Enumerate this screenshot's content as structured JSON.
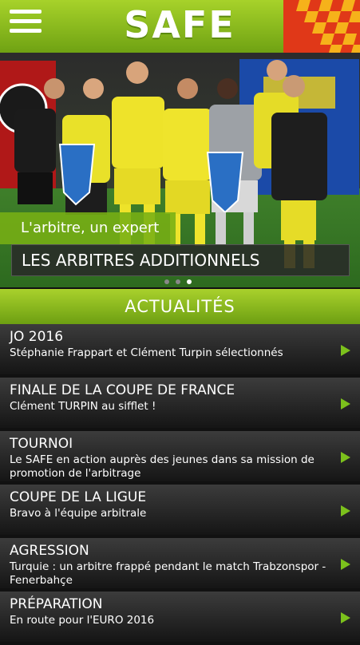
{
  "header": {
    "logo_text": "SAFE",
    "menu_icon": "hamburger-icon",
    "accent": "#8cc21e"
  },
  "hero": {
    "tag": "L'arbitre, un expert",
    "title": "LES ARBITRES ADDITIONNELS",
    "slides_total": 3,
    "active_slide": 3
  },
  "section": {
    "title": "ACTUALITÉS"
  },
  "news": [
    {
      "title": "JO 2016",
      "subtitle": "Stéphanie Frappart et Clément Turpin sélectionnés"
    },
    {
      "title": "FINALE DE LA COUPE DE FRANCE",
      "subtitle": "Clément TURPIN au sifflet !"
    },
    {
      "title": "TOURNOI",
      "subtitle": "Le SAFE en action auprès des jeunes dans sa mission de promotion de l'arbitrage"
    },
    {
      "title": "COUPE DE LA LIGUE",
      "subtitle": "Bravo à l'équipe arbitrale"
    },
    {
      "title": "AGRESSION",
      "subtitle": "Turquie : un arbitre frappé pendant le match Trabzonspor - Fenerbahçe"
    },
    {
      "title": "PRÉPARATION",
      "subtitle": "En route pour l'EURO 2016"
    }
  ]
}
